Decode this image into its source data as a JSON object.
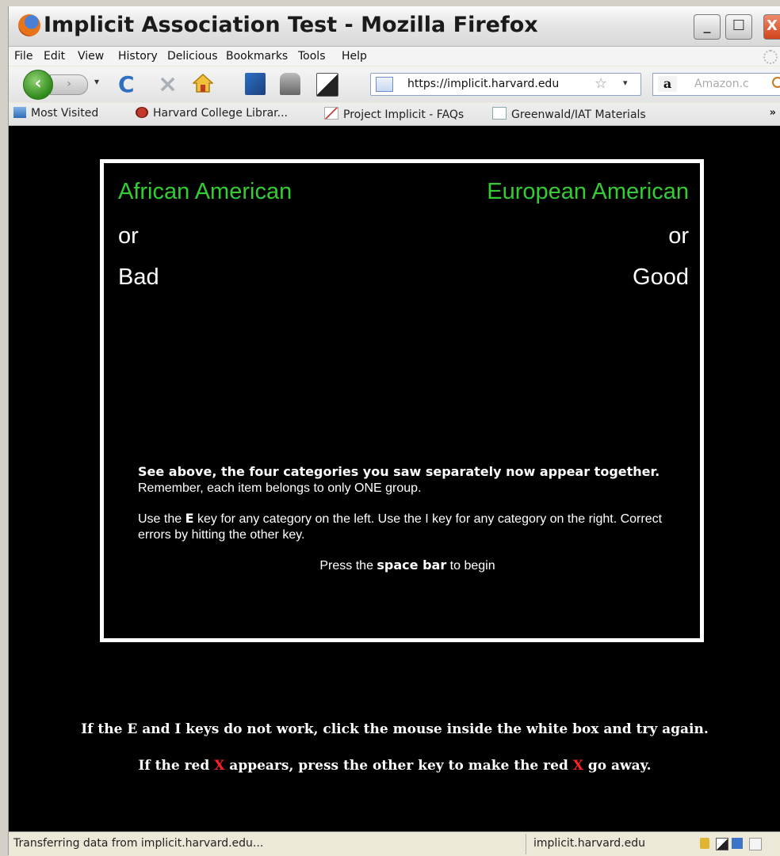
{
  "window": {
    "title": "Implicit Association Test - Mozilla Firefox",
    "minimize_label": "_",
    "maximize_label": "☐",
    "close_label": "X"
  },
  "menubar": [
    "File",
    "Edit",
    "View",
    "History",
    "Delicious",
    "Bookmarks",
    "Tools",
    "Help"
  ],
  "toolbar": {
    "url": "https://implicit.harvard.edu",
    "search_placeholder": "Amazon.c",
    "search_engine_icon": "a"
  },
  "bookmarks": [
    "Most Visited",
    "Harvard College Librar...",
    "Project Implicit - FAQs",
    "Greenwald/IAT Materials"
  ],
  "bookmarks_overflow": "»",
  "iat": {
    "left_top": "African American",
    "left_or": "or",
    "left_bottom": "Bad",
    "right_top": "European American",
    "right_or": "or",
    "right_bottom": "Good",
    "p1_bold": "See above, the four categories you saw separately now appear together.",
    "p1_rest": " Remember, each item belongs to only ONE group.",
    "p2_a": "Use the ",
    "p2_key_e": "E",
    "p2_b": " key for any category on the left. Use the I key for any category on the right. Correct errors by hitting the other key.",
    "p3_a": "Press the ",
    "p3_key": "space bar",
    "p3_b": " to begin"
  },
  "footer": {
    "line1": "If the E and I keys do not work, click the mouse inside the white box and try again.",
    "line2_a": "If the red ",
    "line2_x1": "X",
    "line2_b": " appears, press the other key to make the red ",
    "line2_x2": "X",
    "line2_c": " go away."
  },
  "statusbar": {
    "left": "Transferring data from implicit.harvard.edu...",
    "right": "implicit.harvard.edu"
  },
  "colors": {
    "category_green": "#33cc33",
    "error_red": "#ff2020",
    "background": "#000000"
  }
}
